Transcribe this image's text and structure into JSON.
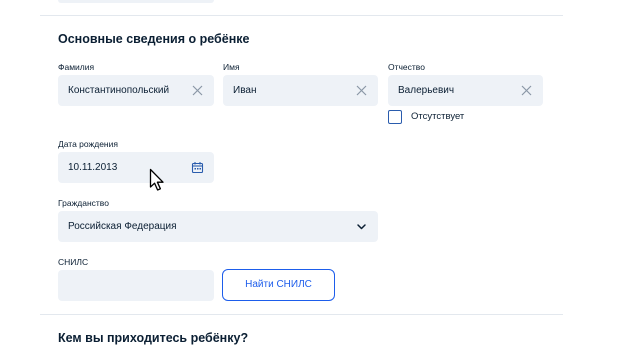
{
  "section_child": {
    "title": "Основные сведения о ребёнке",
    "surname": {
      "label": "Фамилия",
      "value": "Константинопольский"
    },
    "name": {
      "label": "Имя",
      "value": "Иван"
    },
    "patronymic": {
      "label": "Отчество",
      "value": "Валерьевич",
      "absent_label": "Отсутствует",
      "absent_checked": false
    },
    "birth_date": {
      "label": "Дата рождения",
      "value": "10.11.2013"
    },
    "citizenship": {
      "label": "Гражданство",
      "value": "Российская Федерация"
    },
    "snils": {
      "label": "СНИЛС",
      "value": "",
      "find_button": "Найти СНИЛС"
    }
  },
  "section_relation": {
    "title": "Кем вы приходитесь ребёнку?"
  },
  "icons": {
    "clear": "close-icon",
    "calendar": "calendar-icon",
    "dropdown": "chevron-down-icon",
    "cursor": "mouse-pointer-icon"
  },
  "colors": {
    "field_bg": "#eef2f7",
    "accent": "#1d5deb",
    "text": "#0b1f33",
    "icon": "#8a97a6"
  }
}
